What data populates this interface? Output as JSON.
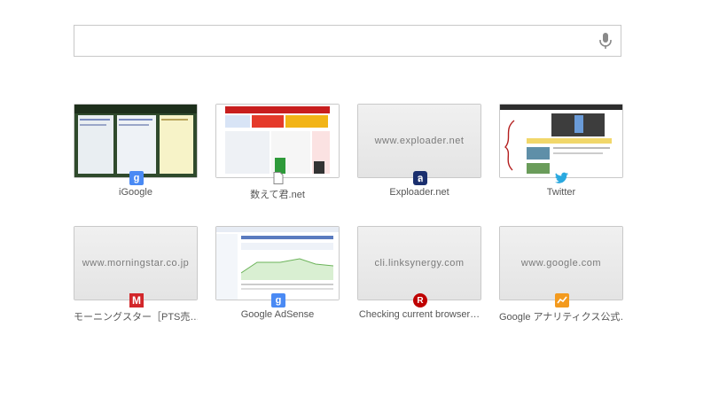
{
  "search": {
    "placeholder": "",
    "value": ""
  },
  "tiles": [
    {
      "title": "iGoogle",
      "url": "",
      "favicon": "google-icon"
    },
    {
      "title": "数えて君.net",
      "url": "",
      "favicon": "page-icon"
    },
    {
      "title": "Exploader.net",
      "url": "www.exploader.net",
      "favicon": "exploader-icon"
    },
    {
      "title": "Twitter",
      "url": "",
      "favicon": "twitter-icon"
    },
    {
      "title": "モーニングスター［PTS売…",
      "url": "www.morningstar.co.jp",
      "favicon": "morningstar-icon"
    },
    {
      "title": "Google AdSense",
      "url": "",
      "favicon": "google-icon"
    },
    {
      "title": "Checking current browser…",
      "url": "cli.linksynergy.com",
      "favicon": "rakuten-icon"
    },
    {
      "title": "Google アナリティクス公式…",
      "url": "www.google.com",
      "favicon": "analytics-icon"
    }
  ],
  "favicon_glyphs": {
    "google": "g",
    "exploader": "ล",
    "morningstar": "M",
    "rakuten": "R"
  },
  "colors": {
    "google": "#4a8af4",
    "twitter": "#2aa9e0",
    "exploader": "#1a2f6e",
    "morningstar": "#d2262a",
    "rakuten": "#bf0000",
    "analytics": "#f39a1e"
  }
}
